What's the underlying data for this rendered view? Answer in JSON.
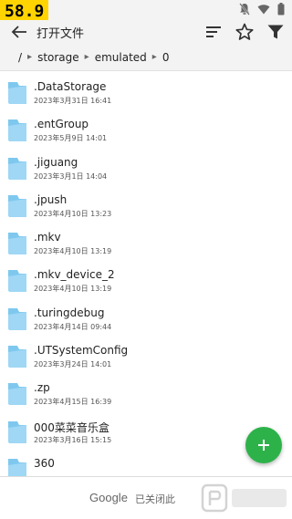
{
  "status_bar": {
    "fps": "58.9"
  },
  "toolbar": {
    "title": "打开文件"
  },
  "breadcrumb": [
    "/",
    "storage",
    "emulated",
    "0"
  ],
  "files": [
    {
      "name": ".DataStorage",
      "date": "2023年3月31日 16:41"
    },
    {
      "name": ".entGroup",
      "date": "2023年5月9日 14:01"
    },
    {
      "name": ".jiguang",
      "date": "2023年3月1日 14:04"
    },
    {
      "name": ".jpush",
      "date": "2023年4月10日 13:23"
    },
    {
      "name": ".mkv",
      "date": "2023年4月10日 13:19"
    },
    {
      "name": ".mkv_device_2",
      "date": "2023年4月10日 13:19"
    },
    {
      "name": ".turingdebug",
      "date": "2023年4月14日 09:44"
    },
    {
      "name": ".UTSystemConfig",
      "date": "2023年3月24日 14:01"
    },
    {
      "name": ".zp",
      "date": "2023年4月15日 16:39"
    },
    {
      "name": "000菜菜音乐盒",
      "date": "2023年3月16日 15:15"
    },
    {
      "name": "360",
      "date": ""
    }
  ],
  "ad": {
    "brand": "Google",
    "text": "已关闭此"
  },
  "colors": {
    "fab": "#2db24a",
    "folder": "#7ec8ef",
    "fps_badge": "#ffd400"
  }
}
